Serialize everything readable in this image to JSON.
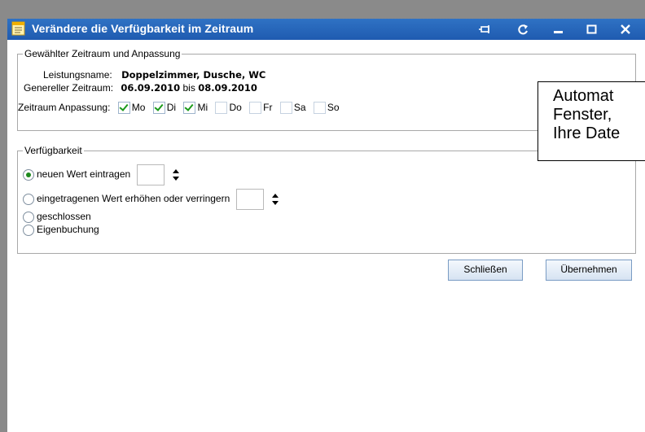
{
  "window": {
    "title": "Verändere die Verfügbarkeit im Zeitraum"
  },
  "group_period": {
    "legend": "Gewählter Zeitraum und Anpassung",
    "service_label": "Leistungsname:",
    "service_value": "Doppelzimmer, Dusche, WC",
    "period_label": "Genereller Zeitraum:",
    "period_from": "06.09.2010",
    "period_bis": "bis",
    "period_to": "08.09.2010",
    "adjust_label": "Zeitraum Anpassung:",
    "days": [
      {
        "label": "Mo",
        "checked": true
      },
      {
        "label": "Di",
        "checked": true
      },
      {
        "label": "Mi",
        "checked": true
      },
      {
        "label": "Do",
        "checked": false
      },
      {
        "label": "Fr",
        "checked": false
      },
      {
        "label": "Sa",
        "checked": false
      },
      {
        "label": "So",
        "checked": false
      }
    ]
  },
  "group_availability": {
    "legend": "Verfügbarkeit",
    "options": [
      {
        "label": "neuen Wert eintragen",
        "selected": true
      },
      {
        "label": "eingetragenen Wert erhöhen oder verringern",
        "selected": false
      },
      {
        "label": "geschlossen",
        "selected": false
      },
      {
        "label": "Eigenbuchung",
        "selected": false
      }
    ]
  },
  "buttons": {
    "close": "Schließen",
    "apply": "Übernehmen"
  },
  "popup": {
    "lines": [
      "Automat",
      "Fenster,",
      "Ihre Date"
    ]
  },
  "colors": {
    "titlebar": "#2f72c4",
    "check": "#1a9a1a",
    "radio_dot": "#1e8a1e"
  }
}
